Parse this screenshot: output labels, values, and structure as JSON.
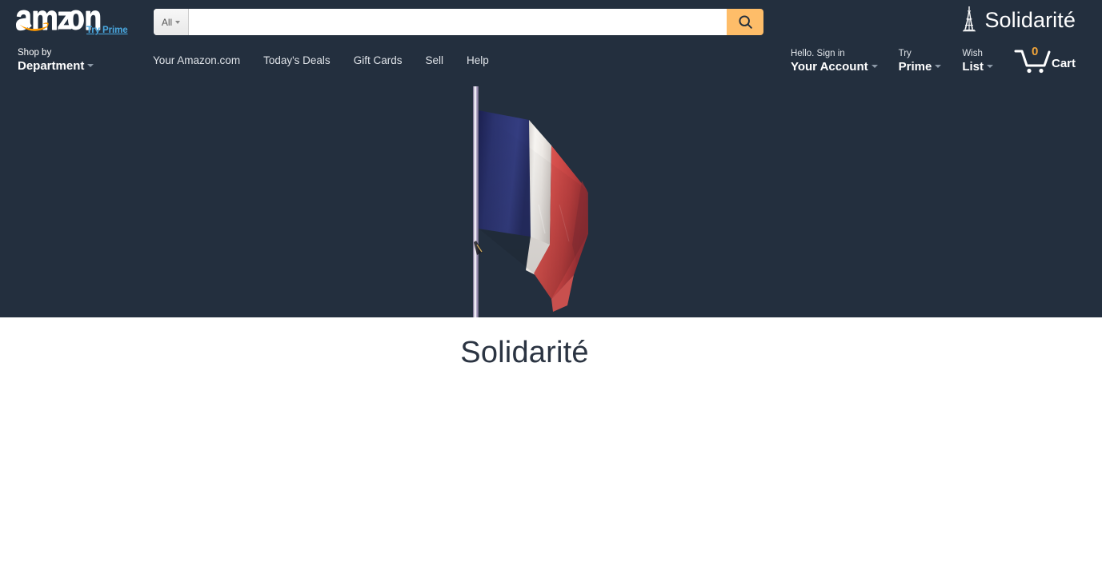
{
  "page": {
    "title": "Solidarité",
    "background_color": "#ffffff"
  },
  "header": {
    "background_color": "#232f3e",
    "logo": {
      "name": "amazon",
      "alt": "amazon",
      "try_prime_label": "Try Prime",
      "try_prime_color": "#4aa8e0"
    },
    "search": {
      "scope_label": "All",
      "scope_icon": "chevron-down-icon",
      "input_value": "",
      "placeholder": "",
      "button_icon": "search-icon",
      "button_color": "#febd69"
    },
    "brand": {
      "icon": "eiffel-tower-icon",
      "label": "Solidarité"
    },
    "shop_by": {
      "line1": "Shop by",
      "line2": "Department",
      "caret_icon": "chevron-down-icon"
    },
    "nav_links": [
      {
        "label": "Your Amazon.com"
      },
      {
        "label": "Today's Deals"
      },
      {
        "label": "Gift Cards"
      },
      {
        "label": "Sell"
      },
      {
        "label": "Help"
      }
    ],
    "account": [
      {
        "id": "your-account",
        "line1": "Hello. Sign in",
        "line2": "Your Account",
        "caret_icon": "chevron-down-icon"
      },
      {
        "id": "try-prime",
        "line1": "Try",
        "line2": "Prime",
        "caret_icon": "chevron-down-icon"
      },
      {
        "id": "wish-list",
        "line1": "Wish",
        "line2": "List",
        "caret_icon": "chevron-down-icon"
      }
    ],
    "cart": {
      "icon": "shopping-cart-icon",
      "count": "0",
      "count_color": "#f0a43a",
      "label": "Cart"
    }
  },
  "hero": {
    "background_color": "#232f3e",
    "image_alt": "French flag at half-mast on a pole",
    "flag_colors": {
      "blue": "#2a3370",
      "white": "#f3f1ee",
      "red": "#d85a56",
      "pole": "#b9b0c9"
    }
  },
  "main": {
    "heading": "Solidarité",
    "heading_color": "#2b3442"
  }
}
